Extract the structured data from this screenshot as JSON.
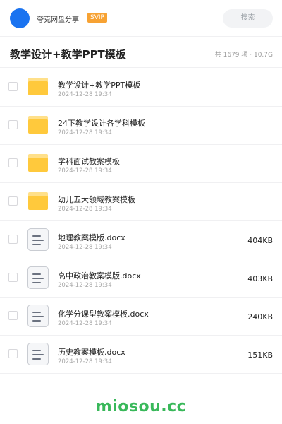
{
  "header": {
    "user_name": "夸克网盘分享",
    "badge": "SVIP",
    "search_placeholder": "搜索",
    "avatar_color": "#1a73f0",
    "badge_color": "#f7a233"
  },
  "folder": {
    "title": "教学设计+教学PPT模板",
    "meta": "共 1679 项 · 10.7G"
  },
  "files": [
    {
      "type": "folder",
      "icon": "folder-icon",
      "name": "教学设计+教学PPT模板",
      "date": "2024-12-28 19:34",
      "size": ""
    },
    {
      "type": "folder",
      "icon": "folder-icon",
      "name": "24下教学设计各学科模板",
      "date": "2024-12-28 19:34",
      "size": ""
    },
    {
      "type": "folder",
      "icon": "folder-icon",
      "name": "学科面试教案模板",
      "date": "2024-12-28 19:34",
      "size": ""
    },
    {
      "type": "folder",
      "icon": "folder-icon",
      "name": "幼儿五大领域教案模板",
      "date": "2024-12-28 19:34",
      "size": ""
    },
    {
      "type": "doc",
      "icon": "document-icon",
      "name": "地理教案模版.docx",
      "date": "2024-12-28 19:34",
      "size": "404KB"
    },
    {
      "type": "doc",
      "icon": "document-icon",
      "name": "高中政治教案模版.docx",
      "date": "2024-12-28 19:34",
      "size": "403KB"
    },
    {
      "type": "doc",
      "icon": "document-icon",
      "name": "化学分课型教案模板.docx",
      "date": "2024-12-28 19:34",
      "size": "240KB"
    },
    {
      "type": "doc",
      "icon": "document-icon",
      "name": "历史教案模板.docx",
      "date": "2024-12-28 19:34",
      "size": "151KB"
    }
  ],
  "watermark": "miosou.cc",
  "colors": {
    "folder_body": "#ffc93c",
    "folder_tab": "#ffe08a",
    "doc_bg": "#f5f6f8",
    "doc_border": "#c9ccd2",
    "doc_lines": "#6b7280",
    "watermark": "#39b85a"
  }
}
